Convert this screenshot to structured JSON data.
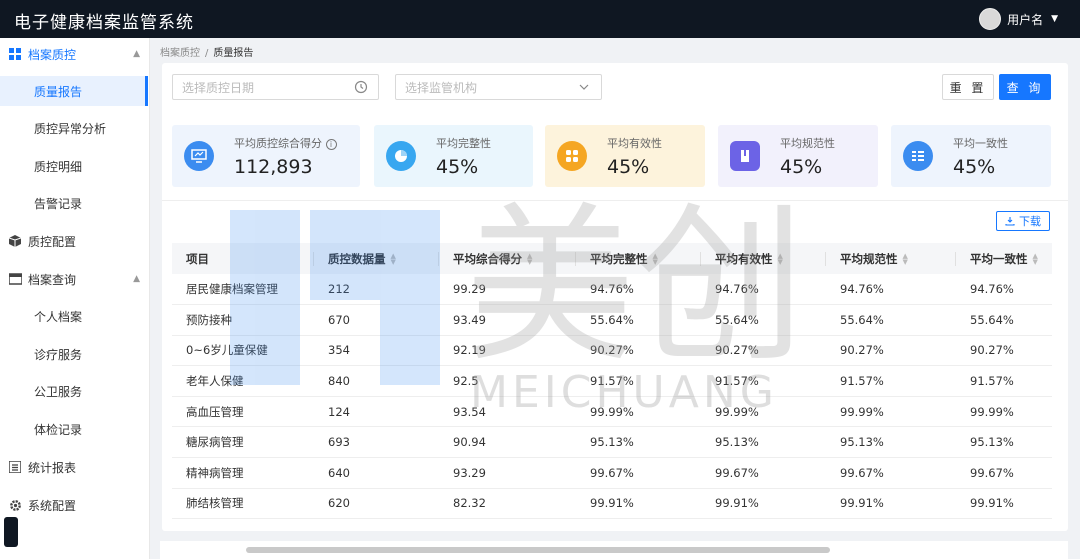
{
  "app": {
    "title": "电子健康档案监管系统",
    "user_name": "用户名"
  },
  "sidebar": {
    "groups": [
      {
        "label": "档案质控",
        "icon": "grid-icon",
        "expanded": true
      },
      {
        "label": "质控配置",
        "icon": "cube-icon"
      },
      {
        "label": "档案查询",
        "icon": "folder-icon",
        "expanded": true
      },
      {
        "label": "统计报表",
        "icon": "report-icon"
      },
      {
        "label": "系统配置",
        "icon": "gear-icon"
      }
    ],
    "qc_items": [
      "质量报告",
      "质控异常分析",
      "质控明细",
      "告警记录"
    ],
    "query_items": [
      "个人档案",
      "诊疗服务",
      "公卫服务",
      "体检记录"
    ]
  },
  "breadcrumb": {
    "parent": "档案质控",
    "separator": "/",
    "current": "质量报告"
  },
  "filters": {
    "date_placeholder": "选择质控日期",
    "org_placeholder": "选择监管机构",
    "reset_label": "重 置",
    "query_label": "查 询"
  },
  "stats": [
    {
      "label": "平均质控综合得分",
      "value": "112,893",
      "icon": "monitor-icon",
      "color": "#3b8cf0",
      "bg": "#eef4fd"
    },
    {
      "label": "平均完整性",
      "value": "45%",
      "icon": "pie-icon",
      "color": "#38a7f0",
      "bg": "#eaf6fd"
    },
    {
      "label": "平均有效性",
      "value": "45%",
      "icon": "apps-icon",
      "color": "#f5a623",
      "bg": "#fdf3dc"
    },
    {
      "label": "平均规范性",
      "value": "45%",
      "icon": "book-icon",
      "color": "#6c63e6",
      "bg": "#f2f1fc"
    },
    {
      "label": "平均一致性",
      "value": "45%",
      "icon": "list-icon",
      "color": "#3b8cf0",
      "bg": "#eef4fd"
    }
  ],
  "download_label": "下载",
  "table": {
    "columns": [
      "项目",
      "质控数据量",
      "平均综合得分",
      "平均完整性",
      "平均有效性",
      "平均规范性",
      "平均一致性"
    ],
    "rows": [
      [
        "居民健康档案管理",
        "212",
        "99.29",
        "94.76%",
        "94.76%",
        "94.76%",
        "94.76%"
      ],
      [
        "预防接种",
        "670",
        "93.49",
        "55.64%",
        "55.64%",
        "55.64%",
        "55.64%"
      ],
      [
        "0~6岁儿童保健",
        "354",
        "92.19",
        "90.27%",
        "90.27%",
        "90.27%",
        "90.27%"
      ],
      [
        "老年人保健",
        "840",
        "92.5",
        "91.57%",
        "91.57%",
        "91.57%",
        "91.57%"
      ],
      [
        "高血压管理",
        "124",
        "93.54",
        "99.99%",
        "99.99%",
        "99.99%",
        "99.99%"
      ],
      [
        "糖尿病管理",
        "693",
        "90.94",
        "95.13%",
        "95.13%",
        "95.13%",
        "95.13%"
      ],
      [
        "精神病管理",
        "640",
        "93.29",
        "99.67%",
        "99.67%",
        "99.67%",
        "99.67%"
      ],
      [
        "肺结核管理",
        "620",
        "82.32",
        "99.91%",
        "99.91%",
        "99.91%",
        "99.91%"
      ]
    ]
  },
  "watermark": {
    "brand": "美创",
    "latin": "MEICHUANG"
  },
  "colors": {
    "accent": "#1677ff",
    "good": "#3fbf6f",
    "bad": "#e84749",
    "topbar": "#0f1722"
  }
}
